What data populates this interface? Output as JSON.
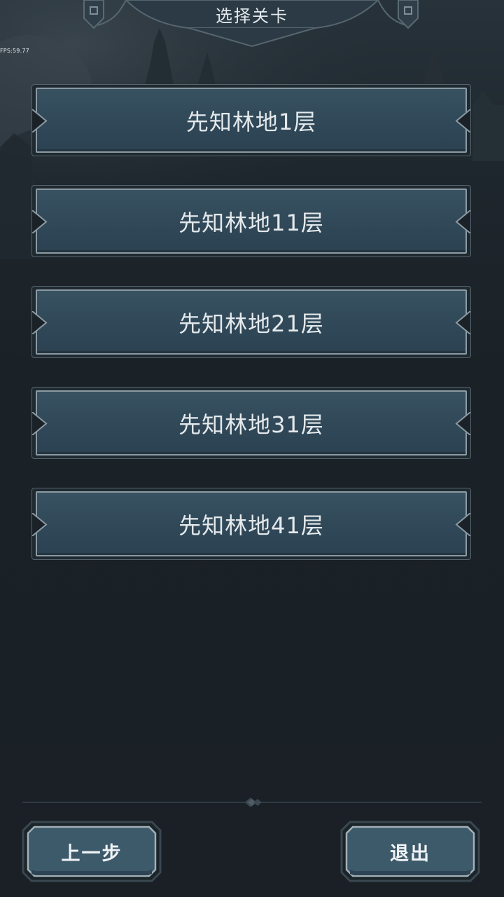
{
  "status": {
    "fps_text": "FPS:59.77"
  },
  "header": {
    "title": "选择关卡"
  },
  "levels": [
    {
      "label": "先知林地1层"
    },
    {
      "label": "先知林地11层"
    },
    {
      "label": "先知林地21层"
    },
    {
      "label": "先知林地31层"
    },
    {
      "label": "先知林地41层"
    }
  ],
  "footer": {
    "back_label": "上一步",
    "exit_label": "退出"
  },
  "colors": {
    "background": "#1b2127",
    "button_fill": "#314a5a",
    "button_border": "#8b9aa3",
    "text": "#e4e9ec"
  }
}
